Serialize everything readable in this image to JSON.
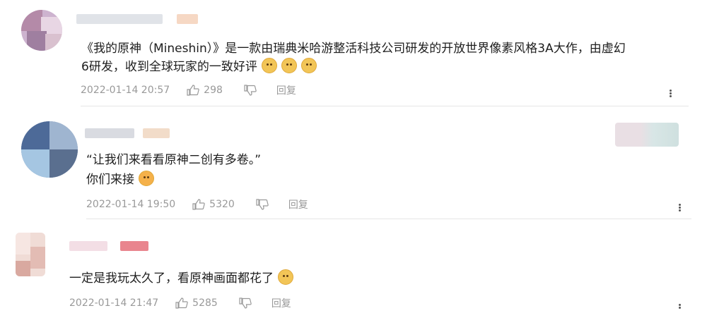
{
  "comments": [
    {
      "text_line1": "《我的原神（Mineshin）》是一款由瑞典米哈游整活科技公司研发的开放世界像素风格3A大作，由虚幻",
      "text_line2": "6研发，收到全球玩家的一致好评",
      "time": "2022-01-14 20:57",
      "likes": "298",
      "reply": "回复",
      "emoji": [
        "cat-face-emoji",
        "cat-face-emoji",
        "cat-face-emoji"
      ]
    },
    {
      "text_line1": "“让我们来看看原神二创有多卷。”",
      "text_line2": "你们来接",
      "time": "2022-01-14 19:50",
      "likes": "5320",
      "reply": "回复",
      "emoji": [
        "blowing-kiss-emoji"
      ]
    },
    {
      "text_line1": "一定是我玩太久了，看原神画面都花了",
      "time": "2022-01-14 21:47",
      "likes": "5285",
      "reply": "回复",
      "emoji": [
        "cat-face-emoji"
      ]
    }
  ],
  "colors": {
    "meta": "#999999",
    "divider": "#e6e6e6",
    "text": "#1e1e1e"
  }
}
